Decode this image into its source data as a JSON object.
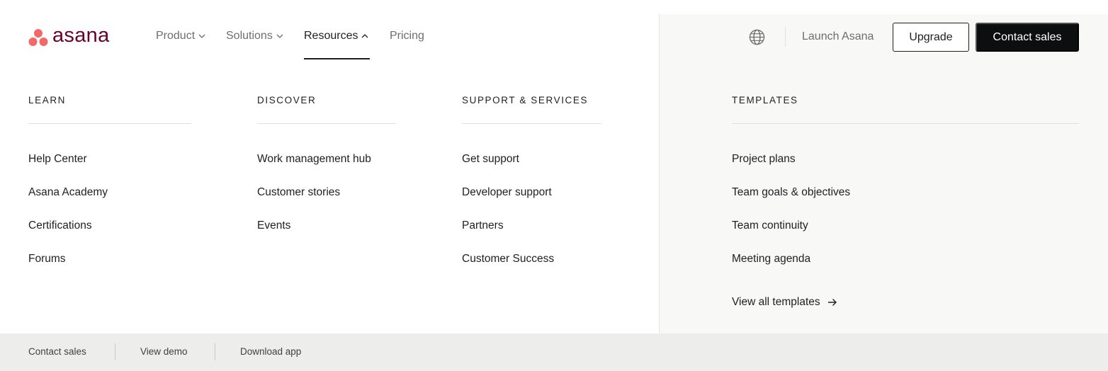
{
  "brand": {
    "name": "asana",
    "dot_color": "#f06a6a",
    "text_color": "#690031"
  },
  "nav": {
    "items": [
      {
        "label": "Product",
        "expanded": false
      },
      {
        "label": "Solutions",
        "expanded": false
      },
      {
        "label": "Resources",
        "expanded": true
      },
      {
        "label": "Pricing"
      }
    ]
  },
  "header": {
    "language_icon": "globe-icon",
    "launch_label": "Launch Asana",
    "upgrade_label": "Upgrade",
    "contact_label": "Contact sales"
  },
  "menu": {
    "learn": {
      "heading": "LEARN",
      "items": [
        "Help Center",
        "Asana Academy",
        "Certifications",
        "Forums"
      ]
    },
    "discover": {
      "heading": "DISCOVER",
      "items": [
        "Work management hub",
        "Customer stories",
        "Events"
      ]
    },
    "support": {
      "heading": "SUPPORT & SERVICES",
      "items": [
        "Get support",
        "Developer support",
        "Partners",
        "Customer Success"
      ]
    },
    "templates": {
      "heading": "TEMPLATES",
      "items": [
        "Project plans",
        "Team goals & objectives",
        "Team continuity",
        "Meeting agenda"
      ],
      "view_all": "View all templates",
      "view_all_icon": "arrow-right-icon"
    }
  },
  "footer": {
    "items": [
      "Contact sales",
      "View demo",
      "Download app"
    ]
  },
  "colors": {
    "accent_dark": "#0d0e10",
    "panel_bg": "#f8f8f7",
    "footer_bg": "#ededeb"
  }
}
